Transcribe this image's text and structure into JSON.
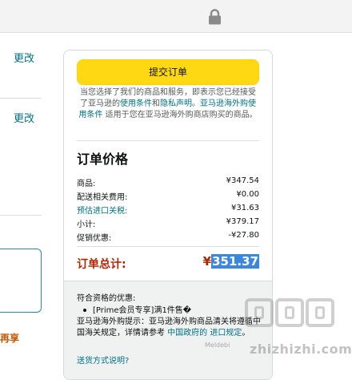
{
  "left": {
    "change_link_1": "更改",
    "change_link_2": "更改",
    "promo_text": "再享"
  },
  "panel": {
    "submit_label": "提交订单",
    "agreement": {
      "prefix": "当您选择了我们的商品和服务，即表示您已经接受了亚马逊的",
      "terms_link": "使用条件",
      "and": "和",
      "privacy_link": "隐私声明",
      "period": "。",
      "overseas_link": "亚马逊海外购使用条件",
      "suffix": " 适用于您在亚马逊海外购商店购买的商品。"
    },
    "summary_title": "订单价格",
    "rows": [
      {
        "label": "商品:",
        "value": "¥347.54",
        "link": false
      },
      {
        "label": "配送相关费用:",
        "value": "¥0.00",
        "link": false
      },
      {
        "label": "预估进口关税:",
        "value": "¥31.63",
        "link": true
      },
      {
        "label": "小计:",
        "value": "¥379.17",
        "link": false
      },
      {
        "label": "促销优惠:",
        "value": "-¥27.80",
        "link": false
      }
    ],
    "total": {
      "label": "订单总计:",
      "currency": "¥",
      "amount": "351.37"
    },
    "promo": {
      "title": "符合资格的优惠:",
      "item": "[Prime会员专享]满1件售�",
      "tip_prefix": "亚马逊海外购提示：亚马逊海外购商品清关将遵循中国海关规定，详情请参考",
      "tip_link": " 中国政府的 进口规定",
      "tip_suffix": "。",
      "ship_link": "送货方式说明?"
    }
  },
  "watermark": {
    "small": "Meldebi",
    "site": "zhizhizhi.com"
  },
  "colors": {
    "button": "#ffd814",
    "link": "#007185",
    "price_red": "#b12704",
    "selection": "#3b87e0"
  }
}
